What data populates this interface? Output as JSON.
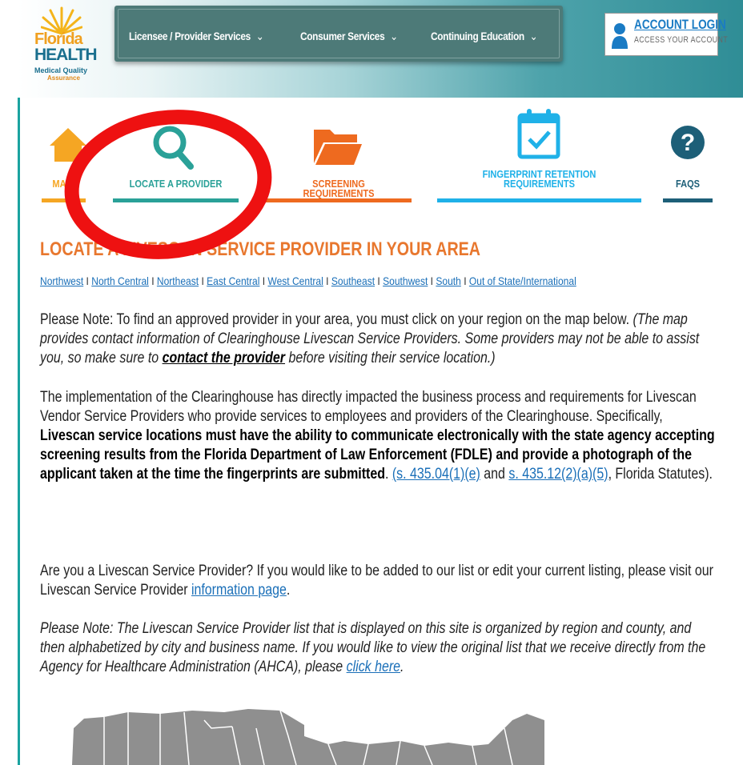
{
  "logo": {
    "line1": "Florida",
    "line2": "HEALTH",
    "line3": "Medical Quality",
    "line4": "Assurance"
  },
  "nav": {
    "items": [
      {
        "label": "Licensee / Provider Services",
        "chevron": "⌄"
      },
      {
        "label": "Consumer Services",
        "chevron": "⌄"
      },
      {
        "label": "Continuing Education",
        "chevron": "⌄"
      }
    ]
  },
  "account": {
    "title": "ACCOUNT LOGIN",
    "subtitle": "ACCESS YOUR ACCOUNT"
  },
  "tabs": [
    {
      "label": "MAIN",
      "color": "#f5a623",
      "icon": "home-icon"
    },
    {
      "label": "LOCATE A PROVIDER",
      "color": "#2aa198",
      "icon": "search-icon"
    },
    {
      "label": "SCREENING REQUIREMENTS",
      "color": "#ee6a1f",
      "icon": "folder-icon"
    },
    {
      "label": "FINGERPRINT RETENTION REQUIREMENTS",
      "color": "#1fb1e8",
      "icon": "calendar-check-icon"
    },
    {
      "label": "FAQS",
      "color": "#1d5f78",
      "icon": "question-icon"
    }
  ],
  "main": {
    "title": "LOCATE A LIVESCAN SERVICE PROVIDER IN YOUR AREA",
    "regions": [
      "Northwest",
      "North Central",
      "Northeast",
      "East Central",
      "West Central",
      "Southeast",
      "Southwest",
      "South",
      "Out of State/International"
    ],
    "region_separator": " I ",
    "note1_plain": "Please Note: To find an approved provider in your area, you must click on your region on the map below. ",
    "note1_italic": "(The map provides contact information of Clearinghouse Livescan Service Providers. Some providers may not be able to assist you, so make sure to ",
    "note1_link": "contact the provider",
    "note1_end": " before visiting their service location.)",
    "impl_plain": "The implementation of the Clearinghouse has directly impacted the business process and requirements for Livescan Vendor Service Providers who provide services to employees and providers of the Clearinghouse. Specifically, ",
    "impl_bold": "Livescan service locations must have the ability to communicate electronically with the state agency accepting screening results from the Florida Department of Law Enforcement (FDLE) and provide a photograph of the applicant taken at the time the fingerprints are submitted",
    "impl_dot": ". ",
    "impl_link1": "(s. 435.04(1)(e)",
    "impl_and": " and ",
    "impl_link2": "s. 435.12(2)(a)(5)",
    "impl_end": ", Florida Statutes).",
    "provider_q": "Are you a Livescan Service Provider? If you would like to be added to our list or edit your current listing, please visit our Livescan Service Provider ",
    "provider_link": "information page",
    "provider_end": ".",
    "note2": "Please Note: The Livescan Service Provider list that is displayed on this site is organized by region and county, and then alphabetized by city and business name. If you would like to view the original list that we receive directly from the Agency for Healthcare Administration (AHCA), please ",
    "note2_link": "click here",
    "note2_end": "."
  }
}
